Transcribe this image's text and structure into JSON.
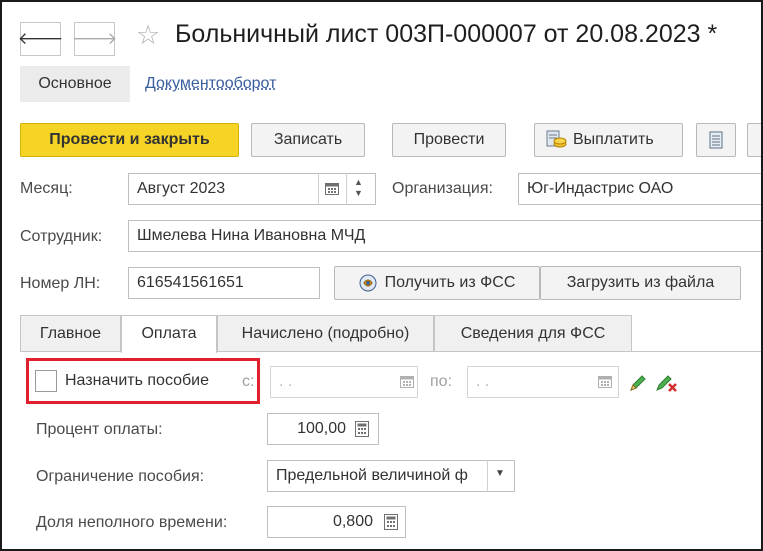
{
  "window": {
    "title": "Больничный лист 003П-000007 от 20.08.2023 *"
  },
  "nav": {
    "back_glyph": "🡐",
    "forward_glyph": "🡒",
    "star_glyph": "☆"
  },
  "section_tabs": [
    {
      "label": "Основное"
    },
    {
      "label": "Документооборот"
    }
  ],
  "toolbar": {
    "post_close_label": "Провести и закрыть",
    "save_label": "Записать",
    "post_label": "Провести",
    "pay_label": "Выплатить"
  },
  "form": {
    "month_label": "Месяц:",
    "month_value": "Август 2023",
    "org_label": "Организация:",
    "org_value": "Юг-Индастрис ОАО",
    "employee_label": "Сотрудник:",
    "employee_value": "Шмелева Нина Ивановна МЧД",
    "ln_label": "Номер ЛН:",
    "ln_value": "616541561651",
    "get_fss_label": "Получить из ФСС",
    "load_file_label": "Загрузить из файла"
  },
  "content_tabs": [
    {
      "label": "Главное"
    },
    {
      "label": "Оплата"
    },
    {
      "label": "Начислено (подробно)"
    },
    {
      "label": "Сведения для ФСС"
    }
  ],
  "payment": {
    "assign_label": "Назначить пособие",
    "from_label": "с:",
    "from_placeholder": " .  .",
    "to_label": "по:",
    "to_placeholder": " .  .",
    "percent_label": "Процент оплаты:",
    "percent_value": "100,00",
    "limit_label": "Ограничение пособия:",
    "limit_value": "Предельной величиной ф",
    "parttime_label": "Доля неполного времени:",
    "parttime_value": "0,800"
  },
  "colors": {
    "primary_button": "#f5d426",
    "highlight_box": "#e0202a",
    "link": "#3a5f9e"
  }
}
